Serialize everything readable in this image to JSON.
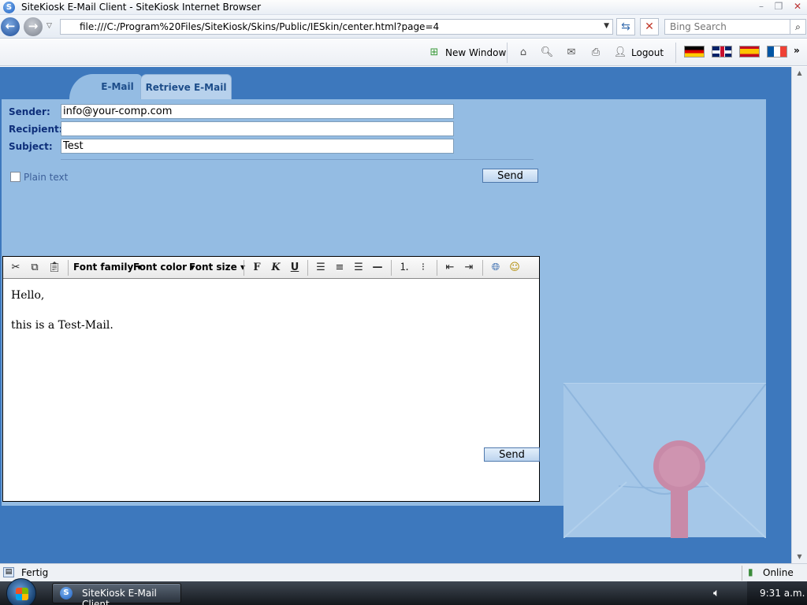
{
  "window": {
    "title": "SiteKiosk E-Mail Client - SiteKiosk Internet Browser",
    "app_icon_letter": "S"
  },
  "address": {
    "url": "file:///C:/Program%20Files/SiteKiosk/Skins/Public/IESkin/center.html?page=4",
    "search_placeholder": "Bing Search"
  },
  "toolbar": {
    "new_window_label": "New Window",
    "logout_label": "Logout",
    "more_label": "»"
  },
  "languages": [
    "German",
    "English",
    "Spanish",
    "French"
  ],
  "tabs": [
    {
      "label": "E-Mail",
      "active": true
    },
    {
      "label": "Retrieve E-Mail",
      "active": false
    }
  ],
  "form": {
    "sender_label": "Sender:",
    "sender_value": "info@your-comp.com",
    "recipient_label": "Recipient:",
    "recipient_value": "",
    "subject_label": "Subject:",
    "subject_value": "Test",
    "plain_text_label": "Plain text",
    "plain_text_checked": false,
    "send_label": "Send"
  },
  "editor": {
    "toolbar": {
      "font_family_label": "Font family",
      "font_color_label": "Font color",
      "font_size_label": "Font size",
      "bold_label": "F",
      "italic_label": "K",
      "underline_label": "U"
    },
    "body_lines": [
      "Hello,",
      "this is a Test-Mail."
    ]
  },
  "status": {
    "text": "Fertig",
    "zone": "Online"
  },
  "taskbar": {
    "item_label": "SiteKiosk E-Mail Client",
    "clock": "9:31 a.m."
  },
  "colors": {
    "page_background": "#3d78bd",
    "panel_background": "#94bce3",
    "label_color": "#0e2f7a",
    "tab_text": "#1d4d8a"
  }
}
